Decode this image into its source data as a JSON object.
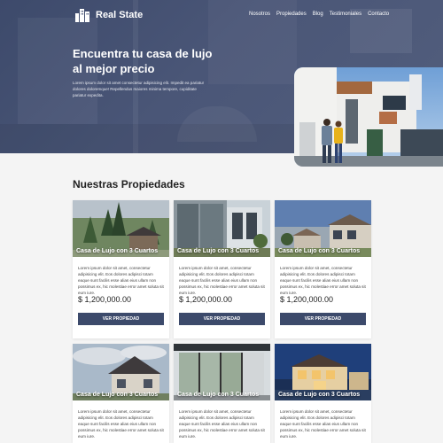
{
  "brand": {
    "name": "Real State"
  },
  "nav": [
    "Nosotros",
    "Propiedades",
    "Blog",
    "Testimoniales",
    "Contacto"
  ],
  "hero": {
    "title": "Encuentra tu casa de lujo al mejor precio",
    "text": "Lorem ipsum dolor sit amet consectetur adipisicing elit. Impedit ea pariatur dolores doloremque! Repellendus maiores minima tempore, cupiditate pariatur expedita."
  },
  "section": {
    "title_light": "Nuestras",
    "title_bold": "Propiedades"
  },
  "cards": [
    {
      "title": "Casa de Lujo con 3 Cuartos",
      "desc": "Lorem ipsum dolor sit amet, consectetur adipisicing elit. Eos dolores adipisci totam eaque sunt facilis esse alias eius ullam non possimus ex, hic molestiae error amet soluta sit eum iure.",
      "price": "$ 1,200,000.00",
      "button": "VER PROPIEDAD"
    },
    {
      "title": "Casa de Lujo con 3 Cuartos",
      "desc": "Lorem ipsum dolor sit amet, consectetur adipisicing elit. Eos dolores adipisci totam eaque sunt facilis esse alias eius ullam non possimus ex, hic molestiae error amet soluta sit eum iure.",
      "price": "$ 1,200,000.00",
      "button": "VER PROPIEDAD"
    },
    {
      "title": "Casa de Lujo con 3 Cuartos",
      "desc": "Lorem ipsum dolor sit amet, consectetur adipisicing elit. Eos dolores adipisci totam eaque sunt facilis esse alias eius ullam non possimus ex, hic molestiae error amet soluta sit eum iure.",
      "price": "$ 1,200,000.00",
      "button": "VER PROPIEDAD"
    },
    {
      "title": "Casa de Lujo con 3 Cuartos",
      "desc": "Lorem ipsum dolor sit amet, consectetur adipisicing elit. Eos dolores adipisci totam eaque sunt facilis esse alias eius ullam non possimus ex, hic molestiae error amet soluta sit eum iure.",
      "price": "",
      "button": ""
    },
    {
      "title": "Casa de Lujo con 3 Cuartos",
      "desc": "Lorem ipsum dolor sit amet, consectetur adipisicing elit. Eos dolores adipisci totam eaque sunt facilis esse alias eius ullam non possimus ex, hic molestiae error amet soluta sit eum iure.",
      "price": "",
      "button": ""
    },
    {
      "title": "Casa de Lujo con 3 Cuartos",
      "desc": "Lorem ipsum dolor sit amet, consectetur adipisicing elit. Eos dolores adipisci totam eaque sunt facilis esse alias eius ullam non possimus ex, hic molestiae error amet soluta sit eum iure.",
      "price": "",
      "button": ""
    }
  ],
  "colors": {
    "hero_overlay": "#4a5677",
    "button": "#3c4a6b",
    "page_bg": "#f4f4f4"
  }
}
